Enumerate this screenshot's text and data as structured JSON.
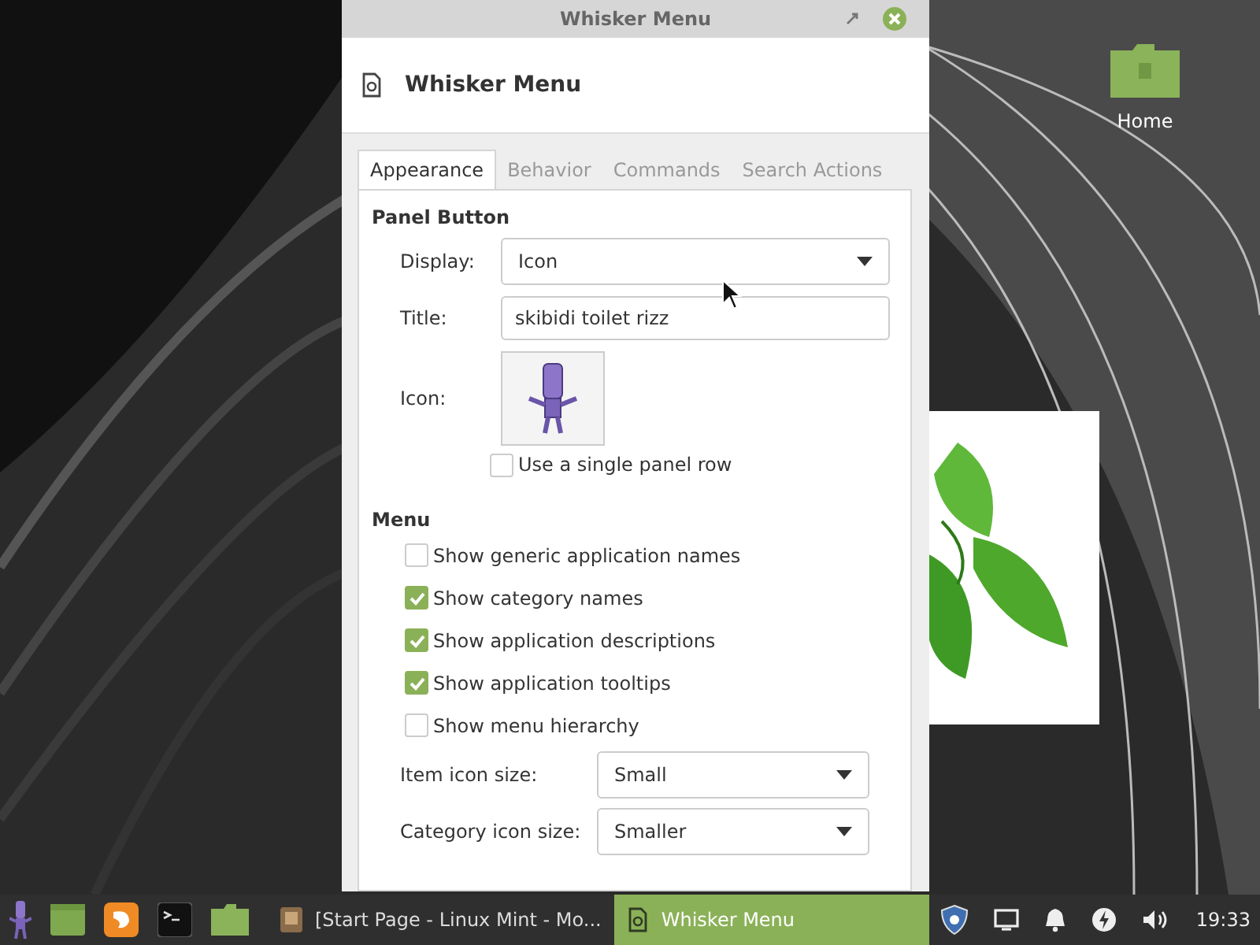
{
  "window": {
    "title": "Whisker Menu",
    "header": "Whisker Menu"
  },
  "tabs": [
    {
      "label": "Appearance",
      "selected": true
    },
    {
      "label": "Behavior",
      "selected": false
    },
    {
      "label": "Commands",
      "selected": false
    },
    {
      "label": "Search Actions",
      "selected": false
    }
  ],
  "panel_button": {
    "heading": "Panel Button",
    "display": {
      "label": "Display:",
      "value": "Icon"
    },
    "title": {
      "label": "Title:",
      "value": "skibidi toilet rizz"
    },
    "icon": {
      "label": "Icon:"
    },
    "single_row": {
      "label": "Use a single panel row",
      "checked": false
    }
  },
  "menu": {
    "heading": "Menu",
    "options": [
      {
        "label": "Show generic application names",
        "checked": false
      },
      {
        "label": "Show category names",
        "checked": true
      },
      {
        "label": "Show application descriptions",
        "checked": true
      },
      {
        "label": "Show application tooltips",
        "checked": true
      },
      {
        "label": "Show menu hierarchy",
        "checked": false
      }
    ],
    "item_icon_size": {
      "label": "Item icon size:",
      "value": "Small"
    },
    "category_icon_size": {
      "label": "Category icon size:",
      "value": "Smaller"
    }
  },
  "desktop": {
    "icons": [
      {
        "label": "Home"
      }
    ]
  },
  "taskbar": {
    "launchers": [
      {
        "kind": "menu"
      },
      {
        "kind": "desktop"
      },
      {
        "kind": "browser"
      },
      {
        "kind": "terminal"
      },
      {
        "kind": "folder"
      }
    ],
    "windows": [
      {
        "label": "[Start Page - Linux Mint - Mo...",
        "kind": "browser",
        "selected": false
      },
      {
        "label": "Whisker Menu",
        "kind": "settings",
        "selected": true
      }
    ],
    "tray": [
      {
        "kind": "shield"
      },
      {
        "kind": "display"
      },
      {
        "kind": "bell"
      },
      {
        "kind": "bolt"
      },
      {
        "kind": "speaker"
      }
    ],
    "clock": "19:33"
  }
}
